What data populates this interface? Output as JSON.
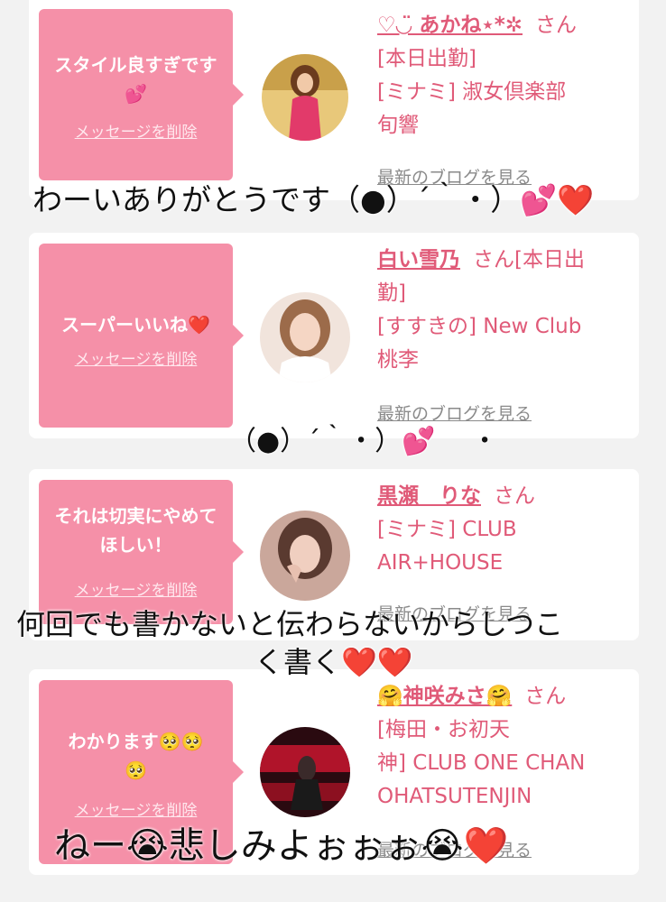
{
  "cards": [
    {
      "message": "スタイル良すぎです💕",
      "delete": "メッセージを削除",
      "name": "♡◡̈ あかね⋆*✲",
      "san": "さん",
      "lines": [
        "[本日出勤]",
        "[ミナミ] 淑女倶楽部",
        "旬響"
      ],
      "blog": "最新のブログを見る"
    },
    {
      "message": "スーパーいいね❤️",
      "delete": "メッセージを削除",
      "name": "白い雪乃",
      "san": "さん[本日出",
      "lines": [
        "勤]",
        "[すすきの] New Club",
        "桃李"
      ],
      "blog": "最新のブログを見る"
    },
    {
      "message": "それは切実にやめてほしい！",
      "delete": "メッセージを削除",
      "name": "黒瀬　りな",
      "san": "さん",
      "lines": [
        "[ミナミ] CLUB",
        "AIR+HOUSE"
      ],
      "blog": "最新のブログを見る"
    },
    {
      "message": "わかります🥺🥺🥺",
      "delete": "メッセージを削除",
      "name": "🤗神咲みさ🤗",
      "san": "さん",
      "lines": [
        "[梅田・お初天",
        "神] CLUB ONE CHAN",
        "OHATSUTENJIN"
      ],
      "blog": "最新のブログを見る"
    }
  ],
  "overlays": {
    "o1": "わーいありがとうです（●）´｀・）💕❤️",
    "o2": "（●）´｀・）💕　 ・",
    "o3a": "何回でも書かないと伝わらないからしつこ",
    "o3b": "く書く❤️❤️",
    "o4": "ねー😭悲しみよぉぉぉ😭❤️"
  },
  "colors": {
    "bubble": "#f590a8",
    "accent": "#e05a78",
    "background": "#f2f2f2"
  }
}
